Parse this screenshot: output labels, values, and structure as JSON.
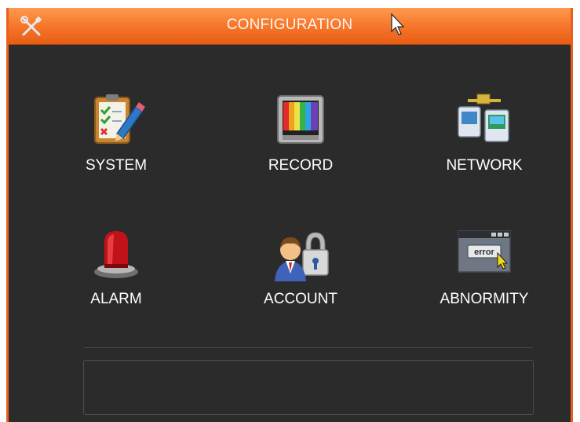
{
  "window": {
    "title": "CONFIGURATION",
    "title_icon": "tools-icon",
    "accent_color": "#f07325",
    "background_color": "#2b2b2b"
  },
  "menu": {
    "items": [
      {
        "label": "SYSTEM",
        "icon": "clipboard-pencil-icon"
      },
      {
        "label": "RECORD",
        "icon": "color-bars-monitor-icon"
      },
      {
        "label": "NETWORK",
        "icon": "network-computers-icon"
      },
      {
        "label": "ALARM",
        "icon": "siren-light-icon"
      },
      {
        "label": "ACCOUNT",
        "icon": "user-lock-icon"
      },
      {
        "label": "ABNORMITY",
        "icon": "error-window-icon"
      }
    ]
  },
  "error_window": {
    "text": "error"
  }
}
